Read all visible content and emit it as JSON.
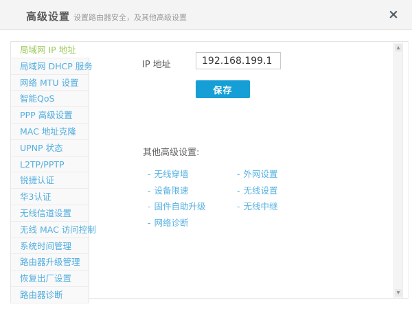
{
  "header": {
    "title": "高级设置",
    "subtitle": "设置路由器安全，及其他高级设置"
  },
  "icons": {
    "close": "×",
    "scroll_up": "▲",
    "scroll_down": "▼"
  },
  "sidebar": {
    "items": [
      {
        "label": "局域网 IP 地址",
        "active": true
      },
      {
        "label": "局域网 DHCP 服务",
        "active": false
      },
      {
        "label": "网络 MTU 设置",
        "active": false
      },
      {
        "label": "智能QoS",
        "active": false
      },
      {
        "label": "PPP 高级设置",
        "active": false
      },
      {
        "label": "MAC 地址克隆",
        "active": false
      },
      {
        "label": "UPNP 状态",
        "active": false
      },
      {
        "label": "L2TP/PPTP",
        "active": false
      },
      {
        "label": "锐捷认证",
        "active": false
      },
      {
        "label": "华3认证",
        "active": false
      },
      {
        "label": "无线信道设置",
        "active": false
      },
      {
        "label": "无线 MAC 访问控制",
        "active": false
      },
      {
        "label": "系统时间管理",
        "active": false
      },
      {
        "label": "路由器升级管理",
        "active": false
      },
      {
        "label": "恢复出厂设置",
        "active": false
      },
      {
        "label": "路由器诊断",
        "active": false
      }
    ]
  },
  "content": {
    "ip_form": {
      "label": "IP 地址",
      "value": "192.168.199.1",
      "save_label": "保存"
    },
    "other": {
      "heading": "其他高级设置:",
      "link_prefix": "-",
      "columns": [
        [
          "无线穿墙",
          "设备限速",
          "固件自助升级",
          "网络诊断"
        ],
        [
          "外网设置",
          "无线设置",
          "无线中继"
        ]
      ]
    }
  },
  "colors": {
    "accent_blue": "#159fd6",
    "sidebar_link_blue": "#51ade0",
    "active_green": "#9ec95c",
    "content_link_blue": "#57b1e1",
    "header_bg": "#f4f4f4"
  }
}
